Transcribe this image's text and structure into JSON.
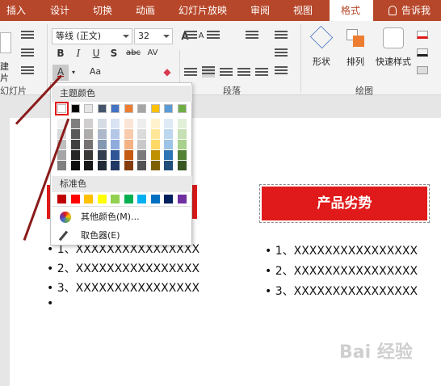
{
  "tabs": [
    "插入",
    "设计",
    "切换",
    "动画",
    "幻灯片放映",
    "审阅",
    "视图",
    "格式"
  ],
  "tell_me": "告诉我",
  "ribbon": {
    "font_name": "等线 (正文)",
    "font_size": "32",
    "left_partial": [
      "建",
      "片",
      "幻灯片"
    ],
    "group_paragraph": "段落",
    "group_drawing": "绘图",
    "shape_label": "形状",
    "arrange_label": "排列",
    "quickstyle_label": "快速样式",
    "bold": "B",
    "italic": "I",
    "underline": "U",
    "shadow": "S",
    "strike": "abc",
    "aa": "Aa"
  },
  "dropdown": {
    "theme_header": "主题颜色",
    "standard_header": "标准色",
    "more_colors": "其他颜色(M)...",
    "eyedropper": "取色器(E)",
    "theme_top": [
      "#ffffff",
      "#000000",
      "#e7e6e6",
      "#44546a",
      "#4472c4",
      "#ed7d31",
      "#a5a5a5",
      "#ffc000",
      "#5b9bd5",
      "#70ad47"
    ],
    "theme_shades": [
      [
        "#f2f2f2",
        "#7f7f7f",
        "#d0cece",
        "#d6dce4",
        "#dae3f3",
        "#fbe5d6",
        "#ededed",
        "#fff2cc",
        "#deebf7",
        "#e2f0d9"
      ],
      [
        "#d9d9d9",
        "#595959",
        "#aeabab",
        "#adb9ca",
        "#b4c7e7",
        "#f8cbad",
        "#dbdbdb",
        "#ffe699",
        "#bdd7ee",
        "#c5e0b4"
      ],
      [
        "#bfbfbf",
        "#404040",
        "#757171",
        "#8497b0",
        "#8faadc",
        "#f4b183",
        "#c9c9c9",
        "#ffd966",
        "#9dc3e6",
        "#a9d18e"
      ],
      [
        "#a6a6a6",
        "#262626",
        "#3b3838",
        "#333f50",
        "#2f5597",
        "#c55a11",
        "#7b7b7b",
        "#bf9000",
        "#2e75b6",
        "#548235"
      ],
      [
        "#808080",
        "#0d0d0d",
        "#171616",
        "#222a35",
        "#203864",
        "#843c0c",
        "#525252",
        "#7f6000",
        "#1f4e79",
        "#385723"
      ]
    ],
    "standard": [
      "#c00000",
      "#ff0000",
      "#ffc000",
      "#ffff00",
      "#92d050",
      "#00b050",
      "#00b0f0",
      "#0070c0",
      "#002060",
      "#7030a0"
    ]
  },
  "slide": {
    "right_title": "产品劣势",
    "left_bullets": [
      "1、XXXXXXXXXXXXXXXX",
      "2、XXXXXXXXXXXXXXXX",
      "3、XXXXXXXXXXXXXXXX",
      ""
    ],
    "right_bullets": [
      "1、XXXXXXXXXXXXXXXX",
      "2、XXXXXXXXXXXXXXXX",
      "3、XXXXXXXXXXXXXXXX"
    ]
  },
  "watermark": "Bai 经验",
  "colors": {
    "accent": "#b7472a",
    "title_red": "#e01a1a",
    "arrow": "#8b1a1a"
  }
}
